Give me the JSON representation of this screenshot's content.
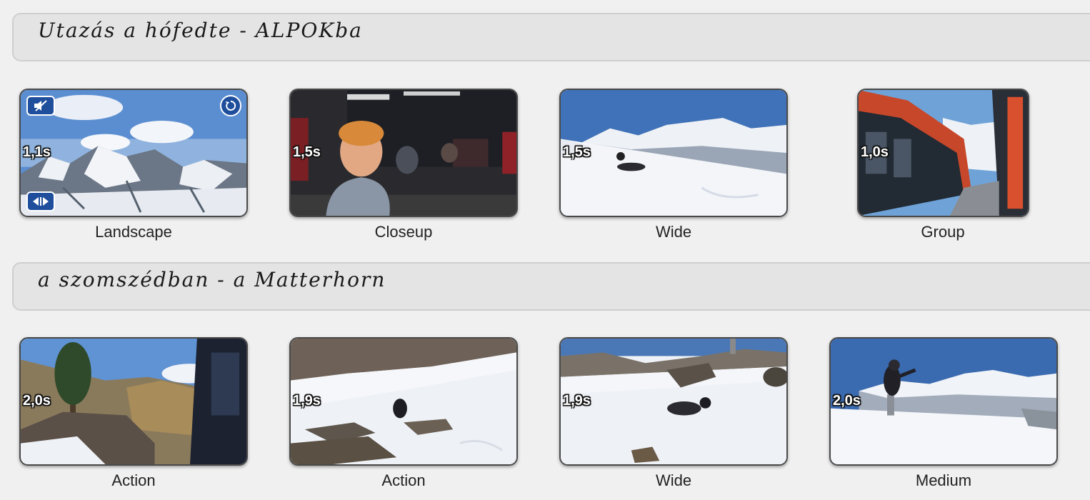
{
  "sections": [
    {
      "title": "Utazás a hófedte - ALPOKba",
      "clips": [
        {
          "label": "Landscape",
          "duration": "1,1s"
        },
        {
          "label": "Closeup",
          "duration": "1,5s"
        },
        {
          "label": "Wide",
          "duration": "1,5s"
        },
        {
          "label": "Group",
          "duration": "1,0s"
        }
      ]
    },
    {
      "title": "a szomszédban - a Matterhorn",
      "clips": [
        {
          "label": "Action",
          "duration": "2,0s"
        },
        {
          "label": "Action",
          "duration": "1,9s"
        },
        {
          "label": "Wide",
          "duration": "1,9s"
        },
        {
          "label": "Medium",
          "duration": "2,0s"
        }
      ]
    }
  ],
  "icons": {
    "mute": "muted-speaker-icon",
    "rotate": "rotate-icon",
    "split": "split-trim-icon"
  },
  "colors": {
    "badge_blue": "#1f4e9c",
    "sky": "#4a7fc0",
    "snow": "#f4f6fa"
  }
}
